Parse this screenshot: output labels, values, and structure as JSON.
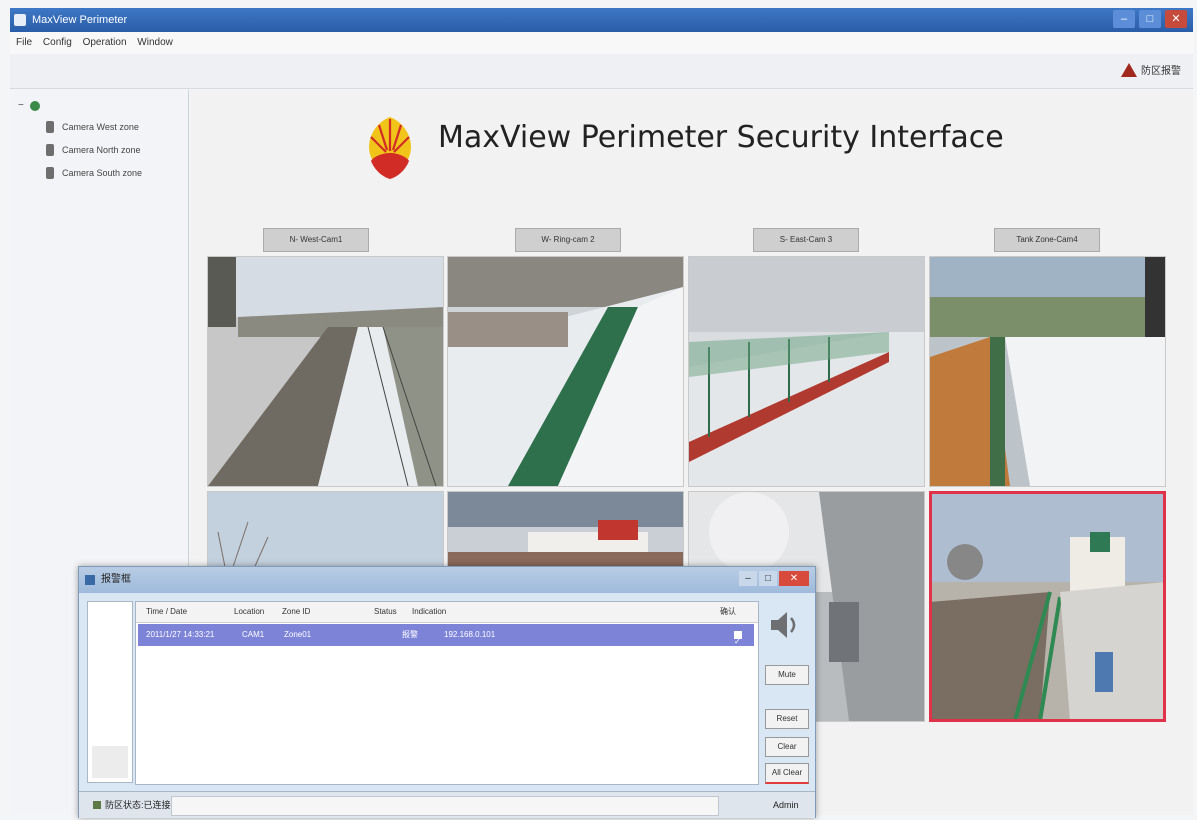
{
  "window": {
    "title": "MaxView Perimeter",
    "controls": [
      "–",
      "□",
      "✕"
    ]
  },
  "menu": [
    "File",
    "Config",
    "Operation",
    "Window"
  ],
  "tray": {
    "label": "防区报警"
  },
  "tree": {
    "expander": "−",
    "items": [
      {
        "label": "Camera West zone"
      },
      {
        "label": "Camera North zone"
      },
      {
        "label": "Camera South zone"
      }
    ]
  },
  "header": {
    "title": "MaxView Perimeter Security Interface"
  },
  "camera_labels": [
    "N- West-Cam1",
    "W- Ring-cam 2",
    "S- East-Cam 3",
    "Tank Zone-Cam4"
  ],
  "tiles": [
    {
      "scene": "road-fence",
      "selected": false
    },
    {
      "scene": "slope-fence",
      "selected": false
    },
    {
      "scene": "wall-fence",
      "selected": false
    },
    {
      "scene": "tank-wall",
      "selected": false
    },
    {
      "scene": "sky-trees",
      "selected": false
    },
    {
      "scene": "buildings",
      "selected": false
    },
    {
      "scene": "foggy-wall",
      "selected": false
    },
    {
      "scene": "alarm-zone",
      "selected": true
    }
  ],
  "alarm_dialog": {
    "title": "报警框",
    "columns": [
      "Time / Date",
      "Location",
      "Zone ID",
      "Status",
      "Indication",
      "确认"
    ],
    "rows": [
      {
        "time": "2011/1/27 14:33:21",
        "location": "CAM1",
        "zone": "Zone01",
        "status": "",
        "indication_label": "报警",
        "indication_value": "192.168.0.101",
        "ack": "✓"
      }
    ],
    "buttons": [
      "Mute",
      "Reset",
      "Clear",
      "All Clear"
    ],
    "status_label": "防区状态:已连接",
    "status_right": "Admin"
  }
}
